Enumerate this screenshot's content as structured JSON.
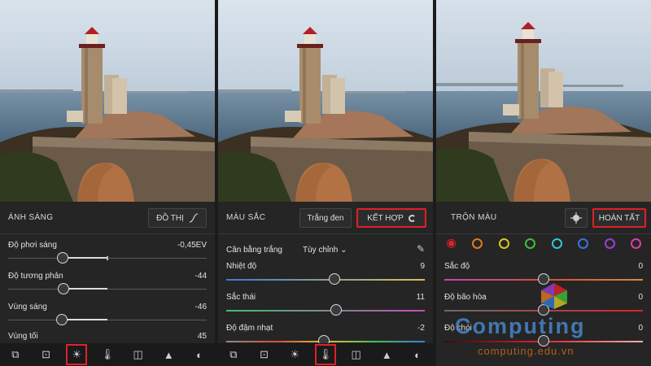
{
  "panels": [
    {
      "section_title": "ÁNH SÁNG",
      "header_button": "ĐỒ THỊ",
      "sliders": [
        {
          "label": "Độ phơi sáng",
          "value": "-0,45EV",
          "level": -0.45
        },
        {
          "label": "Độ tương phản",
          "value": "-44",
          "level": -0.44
        },
        {
          "label": "Vùng sáng",
          "value": "-46",
          "level": -0.46
        },
        {
          "label": "Vùng tối",
          "value": "45",
          "level": 0.45
        }
      ],
      "tools": [
        "crop-icon",
        "presets-icon",
        "light-icon",
        "color-icon",
        "effects-icon",
        "detail-icon",
        "optics-icon"
      ],
      "active_tool": 2
    },
    {
      "section_title": "MÀU SẮC",
      "header_button_secondary": "Trắng đen",
      "header_button": "KẾT HỢP",
      "white_balance_label": "Cân bằng trắng",
      "white_balance_value": "Tùy chỉnh",
      "sliders": [
        {
          "label": "Nhiệt độ",
          "value": "9",
          "level": 0.09
        },
        {
          "label": "Sắc thái",
          "value": "11",
          "level": 0.11
        },
        {
          "label": "Độ đậm nhạt",
          "value": "-2",
          "level": -0.02
        }
      ],
      "tools": [
        "crop-icon",
        "presets-icon",
        "light-icon",
        "color-icon",
        "effects-icon",
        "detail-icon",
        "optics-icon"
      ],
      "active_tool": 3
    },
    {
      "section_title": "TRỘN MÀU",
      "header_button": "HOÀN TẤT",
      "swatches": [
        "#e0202a",
        "#e07a1e",
        "#d8c820",
        "#3fbf3f",
        "#2fc8d8",
        "#2f78e0",
        "#9a3fd8",
        "#d83fa8"
      ],
      "sliders": [
        {
          "label": "Sắc độ",
          "value": "0",
          "level": 0
        },
        {
          "label": "Độ bão hòa",
          "value": "0",
          "level": 0
        },
        {
          "label": "Độ chói",
          "value": "0",
          "level": 0
        }
      ]
    }
  ],
  "watermark": {
    "title": "Computing",
    "url": "computing.edu.vn"
  },
  "colors": {
    "accent_red": "#e0202a",
    "sky": "#c8d6e3",
    "sea": "#5f7d97"
  }
}
